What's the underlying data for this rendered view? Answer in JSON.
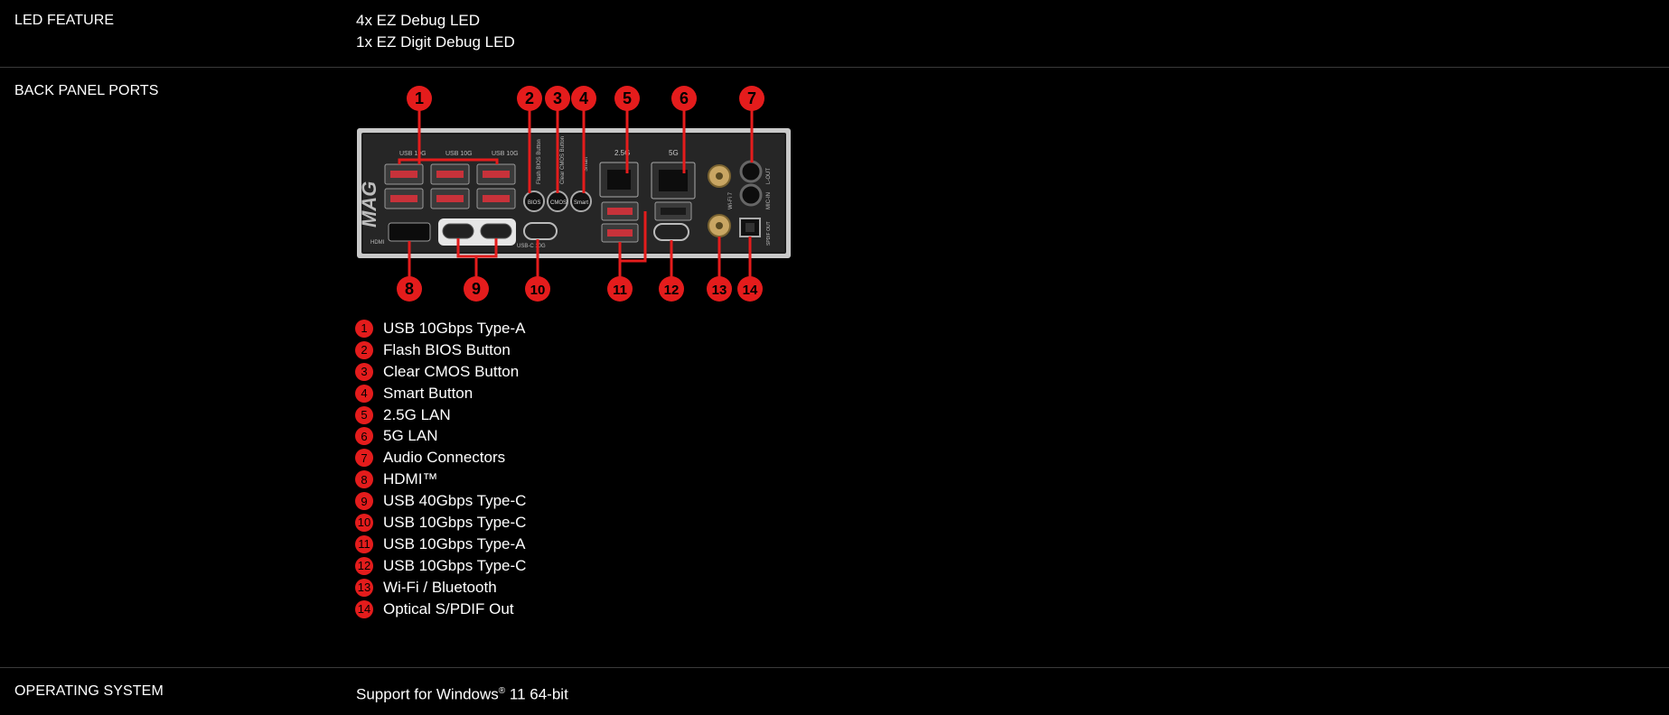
{
  "led": {
    "label": "LED FEATURE",
    "line1": "4x EZ Debug LED",
    "line2": "1x EZ Digit Debug LED"
  },
  "ports": {
    "label": "BACK PANEL PORTS",
    "panel_text": {
      "logo": "MAG",
      "usb": "USB 10G",
      "usbc": "USB-C 10G",
      "flash": "Flash BIOS Button",
      "cmos": "Clear CMOS Button",
      "smart": "Smart",
      "bios": "BIOS",
      "cmos_btn": "CMOS",
      "smart_btn": "Smart",
      "lan25": "2.5G",
      "lan5": "5G",
      "wifi": "Wi-Fi 7",
      "lout": "L-OUT",
      "micin": "MIC-IN",
      "spdif": "SPDIF OUT",
      "hdmi": "HDMI"
    },
    "callouts": [
      "1",
      "2",
      "3",
      "4",
      "5",
      "6",
      "7",
      "8",
      "9",
      "10",
      "11",
      "12",
      "13",
      "14"
    ],
    "items": [
      {
        "num": "1",
        "text": "USB 10Gbps Type-A"
      },
      {
        "num": "2",
        "text": "Flash BIOS Button"
      },
      {
        "num": "3",
        "text": "Clear CMOS Button"
      },
      {
        "num": "4",
        "text": "Smart Button"
      },
      {
        "num": "5",
        "text": "2.5G LAN"
      },
      {
        "num": "6",
        "text": "5G LAN"
      },
      {
        "num": "7",
        "text": "Audio Connectors"
      },
      {
        "num": "8",
        "text": "HDMI™"
      },
      {
        "num": "9",
        "text": "USB 40Gbps Type-C"
      },
      {
        "num": "10",
        "text": "USB 10Gbps Type-C"
      },
      {
        "num": "11",
        "text": "USB 10Gbps Type-A"
      },
      {
        "num": "12",
        "text": "USB 10Gbps Type-C"
      },
      {
        "num": "13",
        "text": "Wi-Fi / Bluetooth"
      },
      {
        "num": "14",
        "text": "Optical S/PDIF Out"
      }
    ]
  },
  "os": {
    "label": "OPERATING SYSTEM",
    "value_prefix": "Support for Windows",
    "value_sup": "®",
    "value_suffix": " 11 64-bit"
  },
  "colors": {
    "accent": "#e41c1c",
    "background": "#000000",
    "divider": "#3a3a3a"
  }
}
